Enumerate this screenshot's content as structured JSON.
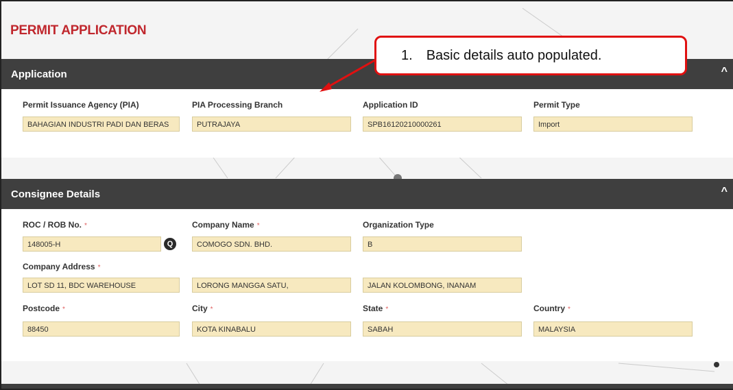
{
  "page_title": "PERMIT APPLICATION",
  "callout": {
    "number": "1.",
    "text": "Basic details auto populated."
  },
  "colors": {
    "title_red": "#c0272d",
    "header_bg": "#3f3f3f",
    "input_bg": "#f7e9bf",
    "callout_border": "#e01010"
  },
  "sections": {
    "application": {
      "title": "Application",
      "collapse_icon": "caret-up-icon",
      "fields": [
        {
          "label": "Permit Issuance Agency (PIA)",
          "value": "BAHAGIAN INDUSTRI PADI DAN BERAS"
        },
        {
          "label": "PIA Processing Branch",
          "value": "PUTRAJAYA"
        },
        {
          "label": "Application ID",
          "value": "SPB16120210000261"
        },
        {
          "label": "Permit Type",
          "value": "Import"
        }
      ]
    },
    "consignee": {
      "title": "Consignee Details",
      "collapse_icon": "caret-up-icon",
      "required_mark": "*",
      "roc_label": "ROC / ROB No.",
      "roc_value": "148005-H",
      "lookup_icon": "search-icon",
      "company_name_label": "Company Name",
      "company_name_value": "COMOGO SDN. BHD.",
      "org_type_label": "Organization Type",
      "org_type_value": "B",
      "address_label": "Company Address",
      "address_line1": "LOT SD 11, BDC WAREHOUSE",
      "address_line2": "LORONG MANGGA SATU,",
      "address_line3": "JALAN KOLOMBONG, INANAM",
      "postcode_label": "Postcode",
      "postcode_value": "88450",
      "city_label": "City",
      "city_value": "KOTA KINABALU",
      "state_label": "State",
      "state_value": "SABAH",
      "country_label": "Country",
      "country_value": "MALAYSIA"
    }
  }
}
